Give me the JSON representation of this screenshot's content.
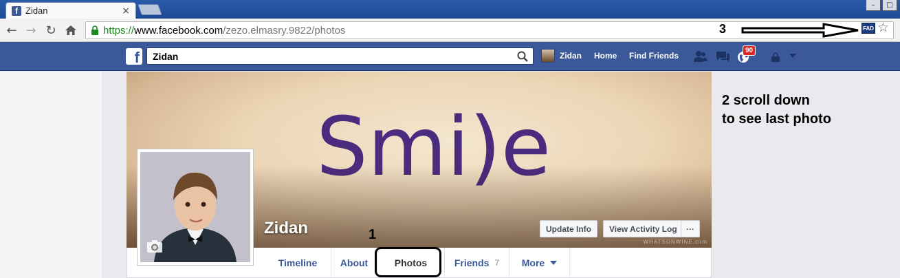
{
  "browser": {
    "tab_title": "Zidan",
    "tab_close": "×",
    "url_scheme": "https://",
    "url_host": "www.facebook.com",
    "url_path": "/zezo.elmasry.9822/photos",
    "extension_label": "FAD",
    "window_buttons": [
      "–",
      "□"
    ]
  },
  "fb_header": {
    "logo": "f",
    "search_value": "Zidan",
    "user_name": "Zidan",
    "home": "Home",
    "find_friends": "Find Friends",
    "notification_count": "90"
  },
  "profile": {
    "cover_text": "Smi)e",
    "name": "Zidan",
    "update_info": "Update Info",
    "view_activity_log": "View Activity Log",
    "more_button": "···",
    "watermark": "WHATSONWINE.com"
  },
  "tabs": [
    {
      "label": "Timeline"
    },
    {
      "label": "About"
    },
    {
      "label": "Photos"
    },
    {
      "label": "Friends",
      "count": "7"
    },
    {
      "label": "More"
    }
  ],
  "annotations": {
    "step1": "1",
    "step2_line1": "2 scroll down",
    "step2_line2": "to see last photo",
    "step3": "3"
  },
  "colors": {
    "fb_blue": "#3b5998",
    "cover_text_purple": "#4b2b7e",
    "badge_red": "#e02525"
  }
}
